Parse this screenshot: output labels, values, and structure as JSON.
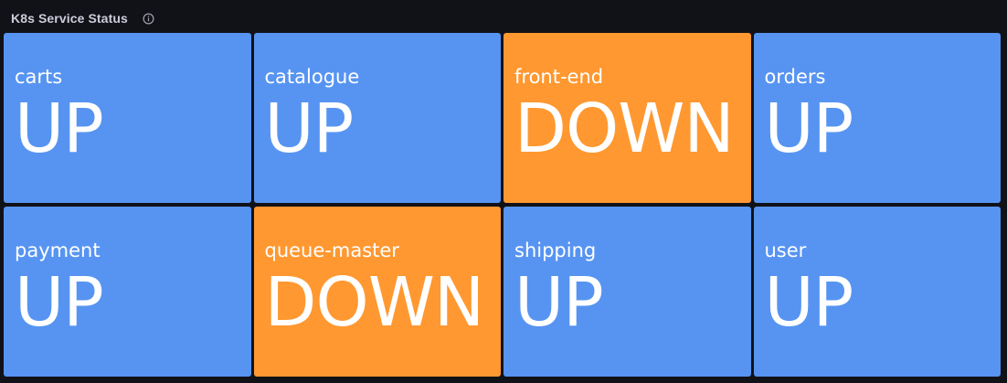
{
  "panel": {
    "title": "K8s Service Status",
    "info_icon": "info-circle-icon"
  },
  "colors": {
    "background": "#111217",
    "up": "#5794f2",
    "down": "#ff9830",
    "text": "#ffffff"
  },
  "services": [
    {
      "name": "carts",
      "status": "UP"
    },
    {
      "name": "catalogue",
      "status": "UP"
    },
    {
      "name": "front-end",
      "status": "DOWN"
    },
    {
      "name": "orders",
      "status": "UP"
    },
    {
      "name": "payment",
      "status": "UP"
    },
    {
      "name": "queue-master",
      "status": "DOWN"
    },
    {
      "name": "shipping",
      "status": "UP"
    },
    {
      "name": "user",
      "status": "UP"
    }
  ]
}
